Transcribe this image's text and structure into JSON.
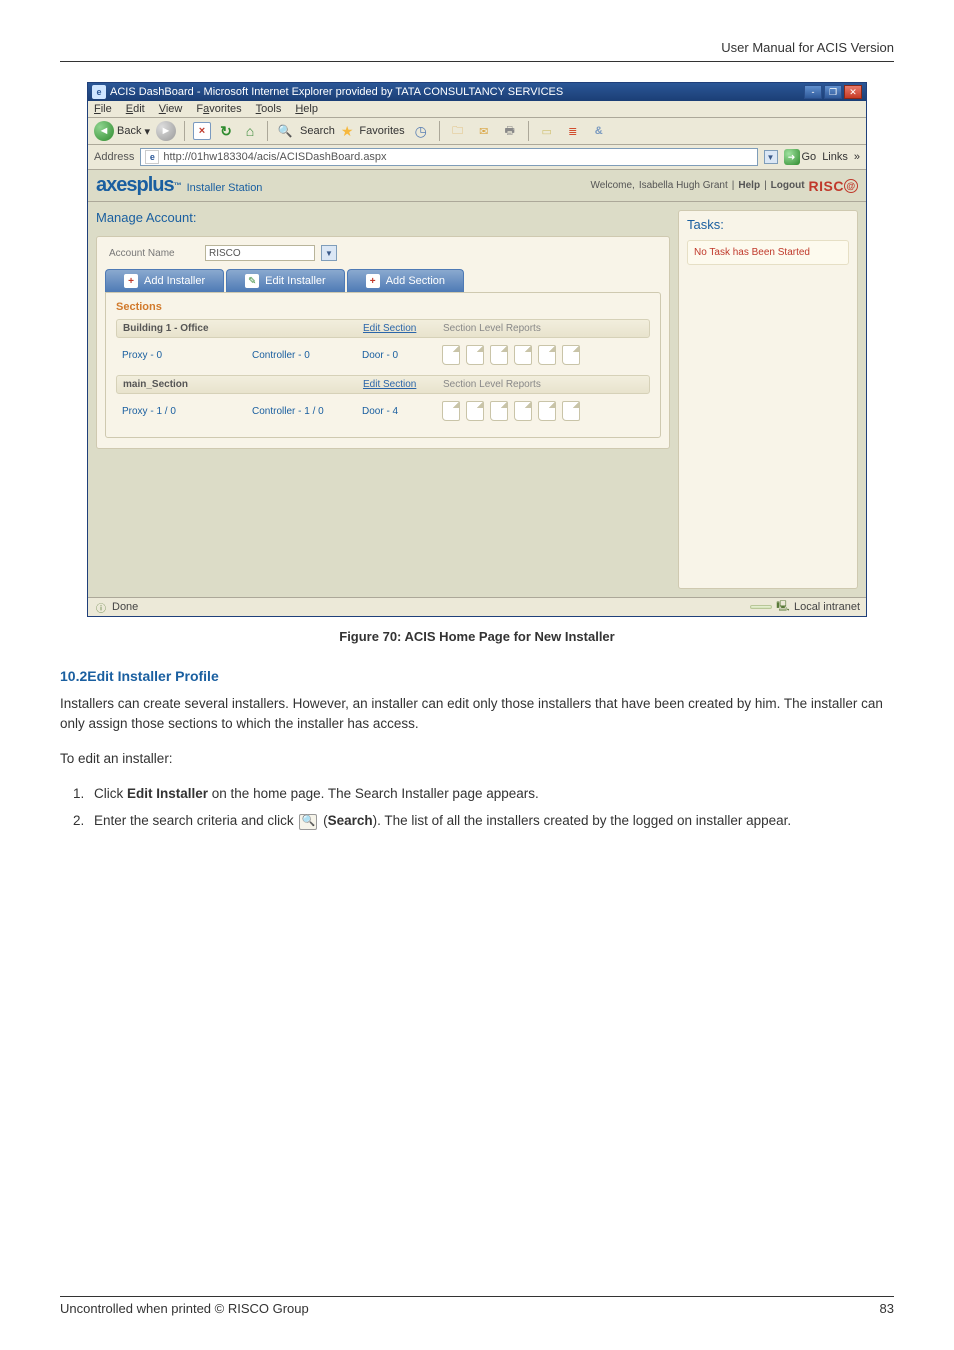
{
  "header": {
    "right_text": "User Manual for ACIS Version"
  },
  "ie": {
    "title": "ACIS DashBoard - Microsoft Internet Explorer provided by TATA CONSULTANCY SERVICES",
    "menu": [
      "File",
      "Edit",
      "View",
      "Favorites",
      "Tools",
      "Help"
    ],
    "back": "Back",
    "search": "Search",
    "favorites": "Favorites",
    "addr_label": "Address",
    "address": "http://01hw183304/acis/ACISDashBoard.aspx",
    "go": "Go",
    "links": "Links",
    "status_done": "Done",
    "status_zone": "Local intranet"
  },
  "app": {
    "brand_logo": "axesplus",
    "brand_sub": "Installer Station",
    "welcome_prefix": "Welcome, ",
    "welcome_name": "Isabella Hugh Grant",
    "help": "Help",
    "logout": "Logout",
    "risco": "RISC",
    "panel_title": "Manage Account:",
    "tasks_title": "Tasks:",
    "no_task": "No Task has Been Started",
    "account_name_lbl": "Account Name",
    "account_name_val": "RISCO",
    "tabs": {
      "add_installer": "Add Installer",
      "edit_installer": "Edit Installer",
      "add_section": "Add Section"
    },
    "sections_title": "Sections",
    "sections": [
      {
        "header": "Building 1 - Office",
        "edit": "Edit Section",
        "reports_lbl": "Section Level Reports",
        "row": {
          "name": "Proxy - 0",
          "controller": "Controller - 0",
          "door": "Door - 0"
        }
      },
      {
        "header": "main_Section",
        "edit": "Edit Section",
        "reports_lbl": "Section Level Reports",
        "row": {
          "name": "Proxy - 1 / 0",
          "controller": "Controller - 1 / 0",
          "door": "Door - 4"
        }
      }
    ]
  },
  "caption": "Figure 70: ACIS Home Page for New Installer",
  "section_head": "10.2Edit Installer Profile",
  "para1": "Installers can create several installers. However, an installer can edit only those installers that have been created by him. The installer can only assign those sections to which the installer has access.",
  "para2": "To edit an installer:",
  "steps": {
    "s1_a": "Click ",
    "s1_bold": "Edit Installer",
    "s1_b": " on the home page. The Search Installer page appears.",
    "s2_a": "Enter the search criteria and click ",
    "s2_paren_open": " (",
    "s2_bold": "Search",
    "s2_b": "). The list of all the installers created by the logged on installer appear."
  },
  "footer": {
    "left": "Uncontrolled when printed © RISCO Group",
    "page": "83"
  }
}
